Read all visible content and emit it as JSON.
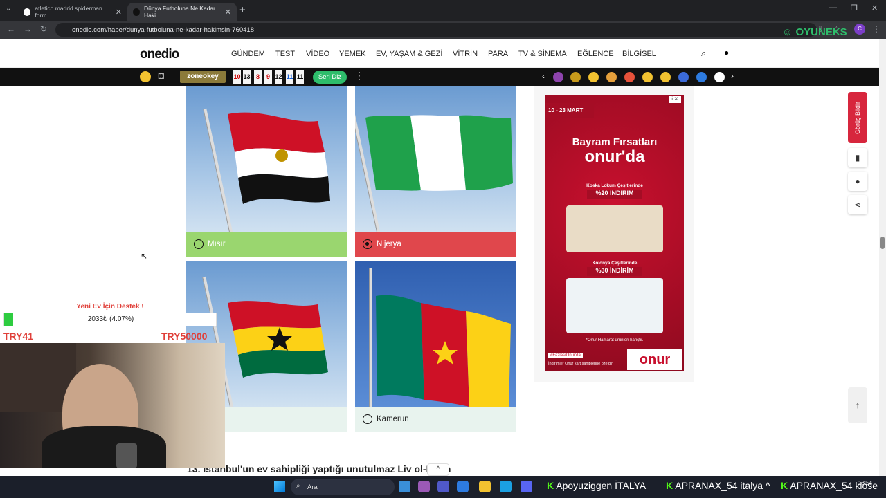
{
  "browser": {
    "tabs": [
      {
        "title": "atletico madrid spiderman form",
        "active": false
      },
      {
        "title": "Dünya Futboluna Ne Kadar Haki",
        "active": true
      }
    ],
    "url": "onedio.com/haber/dunya-futboluna-ne-kadar-hakimsin-760418",
    "profile_initial": "C"
  },
  "site": {
    "logo": "onedio",
    "nav": [
      "GÜNDEM",
      "TEST",
      "VİDEO",
      "YEMEK",
      "EV, YAŞAM & GEZİ",
      "VİTRİN",
      "PARA",
      "TV & SİNEMA",
      "EĞLENCE",
      "BİLGİSEL"
    ],
    "strip": {
      "zone_label": "zoneokey",
      "numbers": [
        "10",
        "13",
        "8",
        "9",
        "12",
        "11",
        "11"
      ],
      "seri_label": "Seri Diz"
    }
  },
  "quiz": {
    "options": [
      {
        "label": "Mısır",
        "state": "correct",
        "color": "#9ad66f"
      },
      {
        "label": "Nijerya",
        "state": "wrong-selected",
        "color": "#e0474c"
      },
      {
        "label": "a",
        "state": "neutral",
        "color": "#e8f3ee"
      },
      {
        "label": "Kamerun",
        "state": "neutral",
        "color": "#e8f3ee"
      }
    ],
    "next_heading": "13. İstanbul'un ev sahipliği yaptığı unutulmaz Liv   ol-Milan"
  },
  "ad": {
    "date": "10 - 23 MART",
    "headline1": "Bayram Fırsatları",
    "headline2": "onur'da",
    "offer1_title": "Koska Lokum Çeşitlerinde",
    "offer1_pct": "%20 İNDİRİM",
    "offer2_title": "Kolonya Çeşitlerinde",
    "offer2_pct": "%30 İNDİRİM",
    "footnote": "*Onur Hamarat ürünleri hariçtir.",
    "hashtag": "#FazlasıOnur'da",
    "bottom": "İndirimler Onur kart sahiplerine özeldir.",
    "brand": "onur"
  },
  "side": {
    "feedback": "Görüş Bildir"
  },
  "overlay": {
    "donate_title": "Yeni Ev İçin Destek !",
    "donate_progress": "2033₺ (4.07%)",
    "donate_fraction": 0.0407,
    "min_label": "TRY41",
    "max_label": "TRY50000"
  },
  "taskbar": {
    "search": "Ara",
    "ticker": [
      "Apoyuziggen İTALYA",
      "APRANAX_54 italya ^",
      "APRANAX_54 klose"
    ],
    "time": "18:54"
  },
  "colors": {
    "brand_red": "#d7263d",
    "correct_green": "#9ad66f",
    "wrong_red": "#e0474c",
    "neutral_bg": "#e8f3ee"
  }
}
